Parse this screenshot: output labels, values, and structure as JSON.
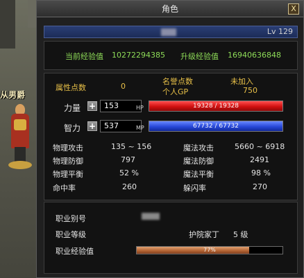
{
  "npc": {
    "name": "从男爵"
  },
  "window": {
    "title": "角色",
    "close": "X"
  },
  "character": {
    "level": "Lv 129"
  },
  "experience": {
    "current_label": "当前经验值",
    "current_value": "10272294385",
    "upgrade_label": "升级经验值",
    "upgrade_value": "16940636848"
  },
  "points": {
    "attr_label": "属性点数",
    "attr_value": "0",
    "honor_label": "名誉点数",
    "honor_value": "未加入",
    "gp_label": "个人GP",
    "gp_value": "750"
  },
  "stats": {
    "str_label": "力量",
    "str_value": "153",
    "int_label": "智力",
    "int_value": "537",
    "plus": "+"
  },
  "hp": {
    "tag": "HP",
    "text": "19328 / 19328",
    "current": 19328,
    "max": 19328,
    "color": "#d01010"
  },
  "mp": {
    "tag": "MP",
    "text": "67732 / 67732",
    "current": 67732,
    "max": 67732,
    "color": "#2848d8"
  },
  "combat": {
    "phys_atk_label": "物理攻击",
    "phys_atk_value": "135 ~ 156",
    "mag_atk_label": "魔法攻击",
    "mag_atk_value": "5660 ~ 6918",
    "phys_def_label": "物理防御",
    "phys_def_value": "797",
    "mag_def_label": "魔法防御",
    "mag_def_value": "2491",
    "phys_bal_label": "物理平衡",
    "phys_bal_value": "52 %",
    "mag_bal_label": "魔法平衡",
    "mag_bal_value": "98 %",
    "hit_label": "命中率",
    "hit_value": "260",
    "dodge_label": "躲闪率",
    "dodge_value": "270"
  },
  "job": {
    "alias_label": "职业别号",
    "level_label": "职业等级",
    "title": "护院家丁",
    "level_value": "5 级",
    "exp_label": "职业经验值",
    "exp_text": "77%",
    "exp_fraction": 0.77,
    "exp_color": "#b06030"
  }
}
